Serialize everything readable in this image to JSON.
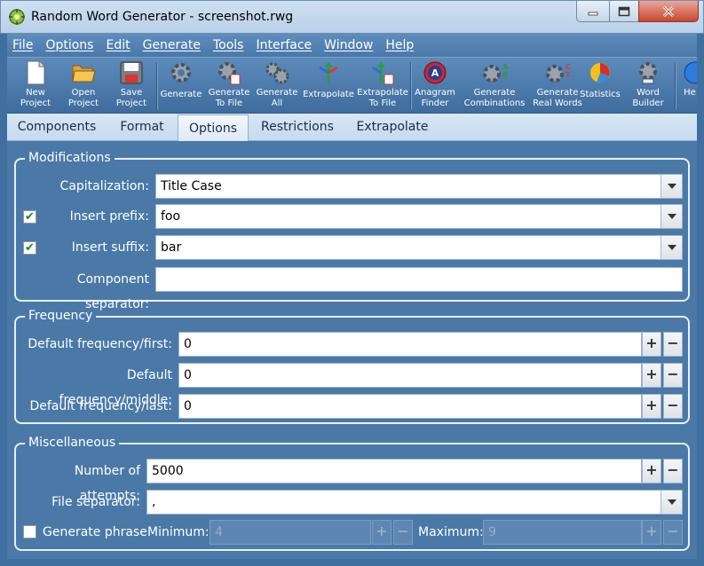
{
  "window": {
    "title": "Random Word Generator - screenshot.rwg"
  },
  "menu": [
    "File",
    "Options",
    "Edit",
    "Generate",
    "Tools",
    "Interface",
    "Window",
    "Help"
  ],
  "toolbar": {
    "new_project": "New\nProject",
    "open_project": "Open\nProject",
    "save_project": "Save\nProject",
    "generate": "Generate",
    "generate_to_file": "Generate\nTo File",
    "generate_all": "Generate\nAll",
    "extrapolate": "Extrapolate",
    "extrapolate_to_file": "Extrapolate\nTo File",
    "anagram_finder": "Anagram\nFinder",
    "generate_combinations": "Generate\nCombinations",
    "generate_real_words": "Generate\nReal Words",
    "statistics": "Statistics",
    "word_builder": "Word\nBuilder",
    "help": "He"
  },
  "tabs": [
    "Components",
    "Format",
    "Options",
    "Restrictions",
    "Extrapolate"
  ],
  "active_tab": "Options",
  "modifications": {
    "title": "Modifications",
    "capitalization_label": "Capitalization:",
    "capitalization_value": "Title Case",
    "prefix_label": "Insert prefix:",
    "prefix_value": "foo",
    "prefix_checked": true,
    "suffix_label": "Insert suffix:",
    "suffix_value": "bar",
    "suffix_checked": true,
    "separator_label": "Component separator:",
    "separator_value": ""
  },
  "frequency": {
    "title": "Frequency",
    "first_label": "Default frequency/first:",
    "first_value": "0",
    "middle_label": "Default frequency/middle:",
    "middle_value": "0",
    "last_label": "Default frequency/last:",
    "last_value": "0"
  },
  "misc": {
    "title": "Miscellaneous",
    "attempts_label": "Number of attempts:",
    "attempts_value": "5000",
    "file_sep_label": "File separator:",
    "file_sep_value": ",",
    "generate_phrase_label": "Generate phrase",
    "generate_phrase_checked": false,
    "minimum_label": "Minimum:",
    "minimum_value": "4",
    "maximum_label": "Maximum:",
    "maximum_value": "9"
  },
  "spin": {
    "plus": "+",
    "minus": "−"
  }
}
